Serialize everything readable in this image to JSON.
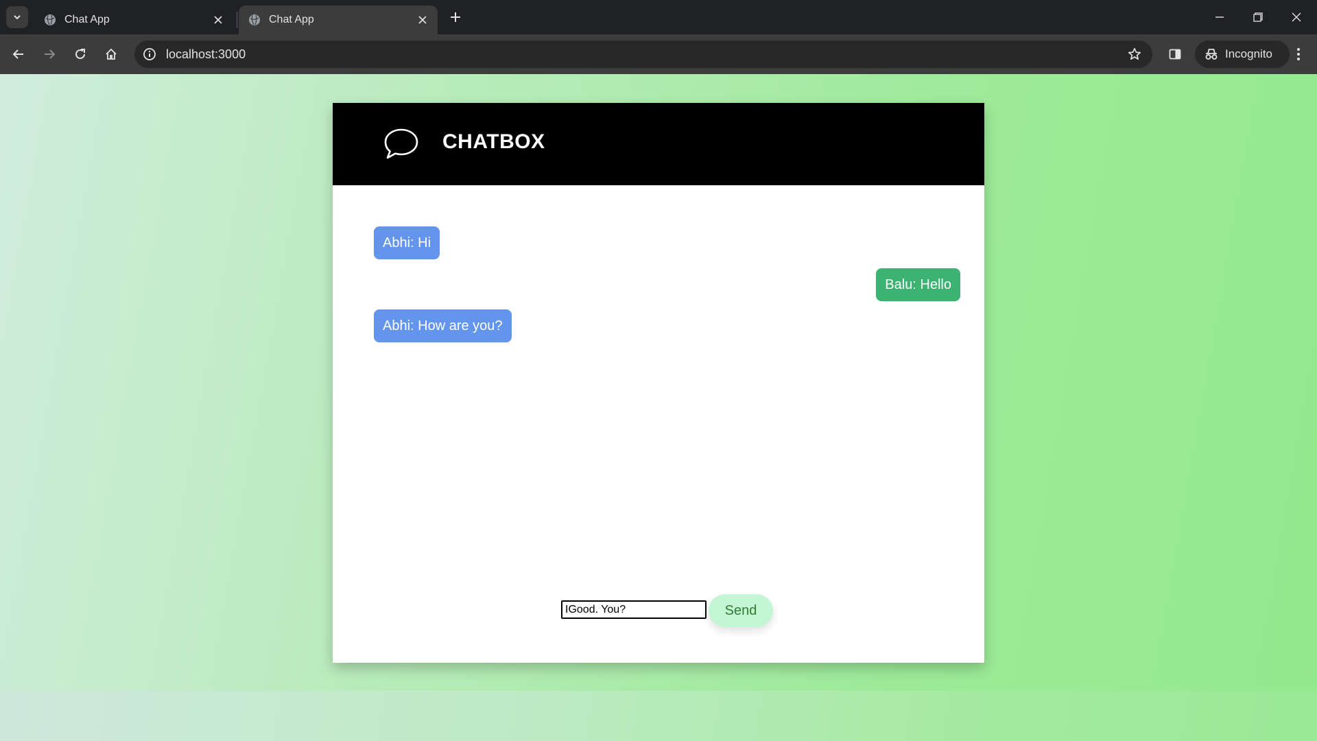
{
  "browser": {
    "tabs": [
      {
        "title": "Chat App",
        "active": false
      },
      {
        "title": "Chat App",
        "active": true
      }
    ],
    "url": "localhost:3000",
    "profile_label": "Incognito"
  },
  "chat": {
    "title": "CHATBOX",
    "logo_icon": "chat-bubble-icon",
    "messages": [
      {
        "text": "Abhi: Hi",
        "side": "left",
        "color": "#6495ED"
      },
      {
        "text": "Balu: Hello",
        "side": "right",
        "color": "#3CB371"
      },
      {
        "text": "Abhi: How are you?",
        "side": "left",
        "color": "#6495ED"
      }
    ],
    "input_value": "IGood. You?",
    "send_label": "Send"
  },
  "colors": {
    "header": "#000000",
    "left_bubble": "#6495ED",
    "right_bubble": "#3CB371",
    "send_button": "#C4F5D5",
    "background_gradient": [
      "#D0ECDC",
      "#93E98E"
    ]
  }
}
